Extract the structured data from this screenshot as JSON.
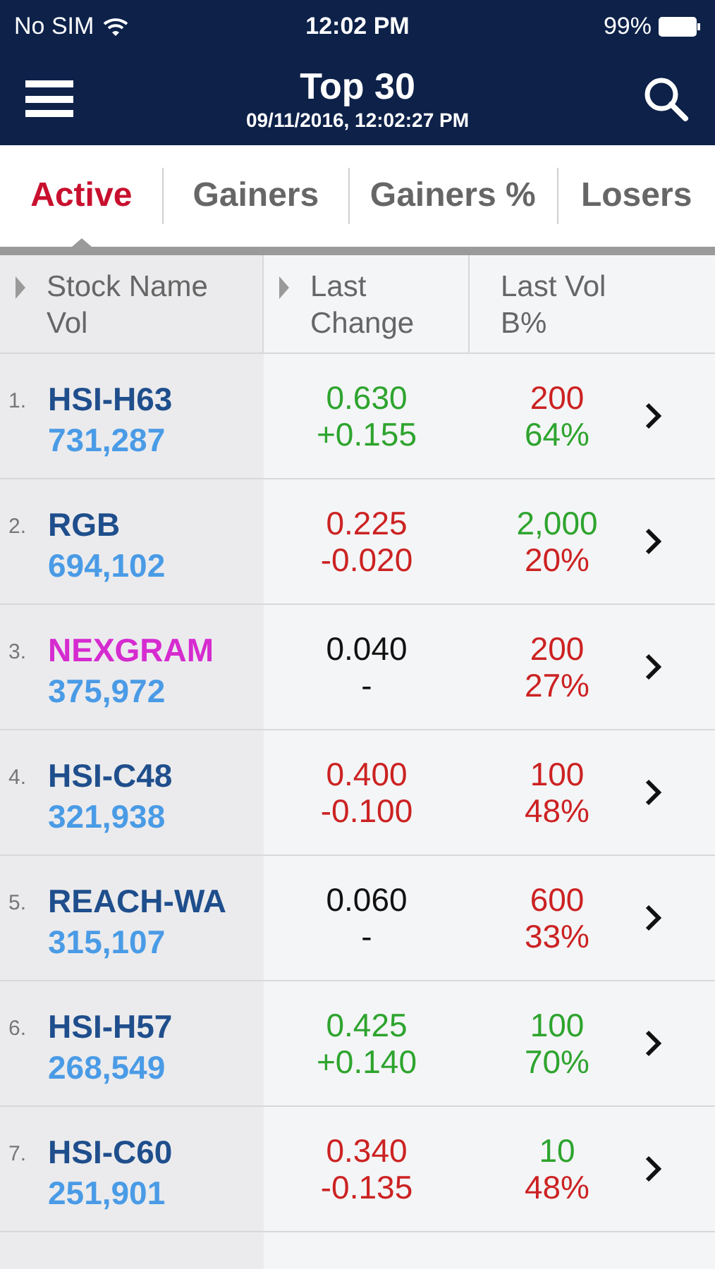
{
  "status_bar": {
    "carrier": "No SIM",
    "time": "12:02 PM",
    "battery": "99%"
  },
  "header": {
    "title": "Top 30",
    "subtitle": "09/11/2016, 12:02:27 PM"
  },
  "tabs": [
    {
      "label": "Active",
      "selected": true
    },
    {
      "label": "Gainers",
      "selected": false
    },
    {
      "label": "Gainers %",
      "selected": false
    },
    {
      "label": "Losers",
      "selected": false
    }
  ],
  "columns": [
    {
      "line1": "Stock Name",
      "line2": "Vol",
      "sortable": true
    },
    {
      "line1": "Last",
      "line2": "Change",
      "sortable": true
    },
    {
      "line1": "Last Vol",
      "line2": "B%",
      "sortable": false
    }
  ],
  "rows": [
    {
      "rank": "1.",
      "name": {
        "text": "HSI-H63",
        "color": "#1f4e8c"
      },
      "vol": "731,287",
      "last": {
        "text": "0.630",
        "color": "#2ea42e"
      },
      "change": {
        "text": "+0.155",
        "color": "#2ea42e"
      },
      "last_vol": {
        "text": "200",
        "color": "#cc2222"
      },
      "b_pct": {
        "text": "64%",
        "color": "#2ea42e"
      }
    },
    {
      "rank": "2.",
      "name": {
        "text": "RGB",
        "color": "#1f4e8c"
      },
      "vol": "694,102",
      "last": {
        "text": "0.225",
        "color": "#cc2222"
      },
      "change": {
        "text": "-0.020",
        "color": "#cc2222"
      },
      "last_vol": {
        "text": "2,000",
        "color": "#2ea42e"
      },
      "b_pct": {
        "text": "20%",
        "color": "#cc2222"
      }
    },
    {
      "rank": "3.",
      "name": {
        "text": "NEXGRAM",
        "color": "#d62bd0"
      },
      "vol": "375,972",
      "last": {
        "text": "0.040",
        "color": "#111111"
      },
      "change": {
        "text": "-",
        "color": "#111111"
      },
      "last_vol": {
        "text": "200",
        "color": "#cc2222"
      },
      "b_pct": {
        "text": "27%",
        "color": "#cc2222"
      }
    },
    {
      "rank": "4.",
      "name": {
        "text": "HSI-C48",
        "color": "#1f4e8c"
      },
      "vol": "321,938",
      "last": {
        "text": "0.400",
        "color": "#cc2222"
      },
      "change": {
        "text": "-0.100",
        "color": "#cc2222"
      },
      "last_vol": {
        "text": "100",
        "color": "#cc2222"
      },
      "b_pct": {
        "text": "48%",
        "color": "#cc2222"
      }
    },
    {
      "rank": "5.",
      "name": {
        "text": "REACH-WA",
        "color": "#1f4e8c"
      },
      "vol": "315,107",
      "last": {
        "text": "0.060",
        "color": "#111111"
      },
      "change": {
        "text": "-",
        "color": "#111111"
      },
      "last_vol": {
        "text": "600",
        "color": "#cc2222"
      },
      "b_pct": {
        "text": "33%",
        "color": "#cc2222"
      }
    },
    {
      "rank": "6.",
      "name": {
        "text": "HSI-H57",
        "color": "#1f4e8c"
      },
      "vol": "268,549",
      "last": {
        "text": "0.425",
        "color": "#2ea42e"
      },
      "change": {
        "text": "+0.140",
        "color": "#2ea42e"
      },
      "last_vol": {
        "text": "100",
        "color": "#2ea42e"
      },
      "b_pct": {
        "text": "70%",
        "color": "#2ea42e"
      }
    },
    {
      "rank": "7.",
      "name": {
        "text": "HSI-C60",
        "color": "#1f4e8c"
      },
      "vol": "251,901",
      "last": {
        "text": "0.340",
        "color": "#cc2222"
      },
      "change": {
        "text": "-0.135",
        "color": "#cc2222"
      },
      "last_vol": {
        "text": "10",
        "color": "#2ea42e"
      },
      "b_pct": {
        "text": "48%",
        "color": "#cc2222"
      }
    }
  ]
}
